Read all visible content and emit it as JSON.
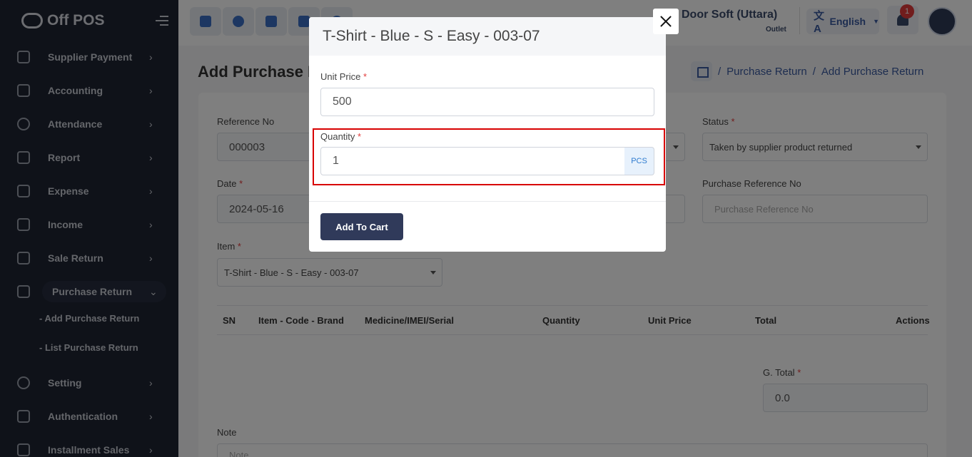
{
  "app": {
    "logo_text": "Off POS"
  },
  "sidebar": {
    "items": [
      {
        "label": "Supplier Payment",
        "chev": "›"
      },
      {
        "label": "Accounting",
        "chev": "›"
      },
      {
        "label": "Attendance",
        "chev": "›"
      },
      {
        "label": "Report",
        "chev": "›"
      },
      {
        "label": "Expense",
        "chev": "›"
      },
      {
        "label": "Income",
        "chev": "›"
      },
      {
        "label": "Sale Return",
        "chev": "›"
      },
      {
        "label": "Purchase Return",
        "chev": "⌄"
      },
      {
        "label": "Setting",
        "chev": "›"
      },
      {
        "label": "Authentication",
        "chev": "›"
      },
      {
        "label": "Installment Sales",
        "chev": "›"
      }
    ],
    "sub_items": [
      "-   Add Purchase Return",
      "-   List Purchase Return"
    ]
  },
  "header": {
    "outlet_name": "Door Soft (Uttara)",
    "outlet_sub": "Outlet",
    "language": "English",
    "lang_glyph": "文A",
    "notification_count": "1"
  },
  "page": {
    "title": "Add Purchase R",
    "breadcrumb": [
      "/",
      "Purchase Return",
      "/",
      "Add Purchase Return"
    ]
  },
  "form": {
    "reference_label": "Reference No",
    "reference_value": "000003",
    "status_label": "Status",
    "status_value": "Taken by supplier product returned",
    "date_label": "Date",
    "date_value": "2024-05-16",
    "purchase_ref_label": "Purchase Reference No",
    "purchase_ref_placeholder": "Purchase Reference No",
    "item_label": "Item",
    "item_value": "T-Shirt - Blue - S - Easy - 003-07",
    "table_headers": [
      "SN",
      "Item - Code - Brand",
      "Medicine/IMEI/Serial",
      "Quantity",
      "Unit Price",
      "Total",
      "Actions"
    ],
    "gtotal_label": "G. Total",
    "gtotal_value": "0.0",
    "note_label": "Note",
    "note_placeholder": "Note"
  },
  "modal": {
    "title": "T-Shirt - Blue - S - Easy - 003-07",
    "unit_price_label": "Unit Price",
    "unit_price_value": "500",
    "quantity_label": "Quantity",
    "quantity_value": "1",
    "unit": "PCS",
    "add_button": "Add To Cart",
    "required_mark": "*"
  }
}
